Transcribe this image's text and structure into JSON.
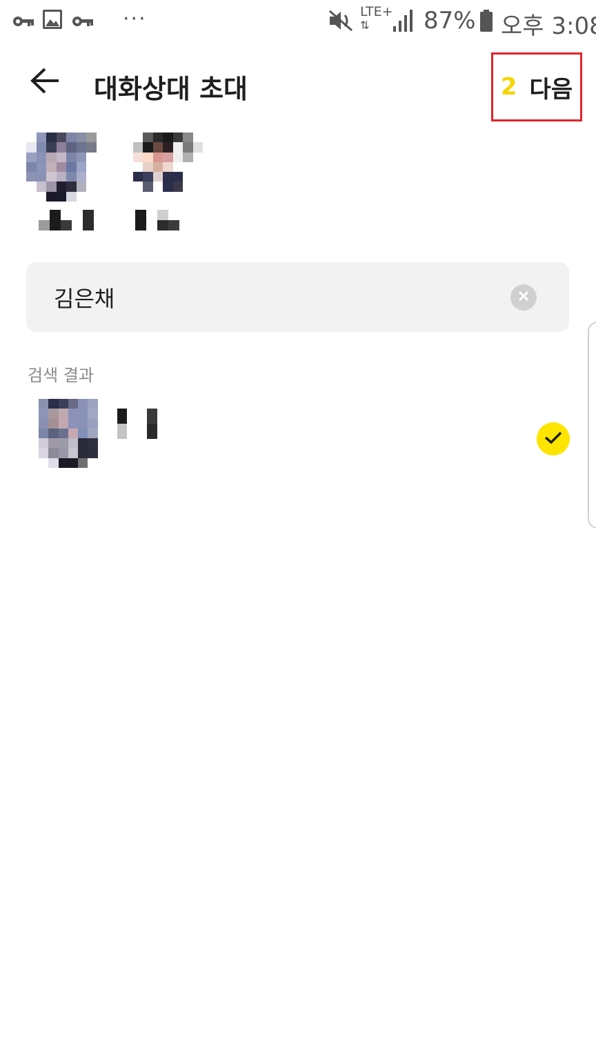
{
  "status_bar": {
    "left_icons": [
      "vpn-key-icon",
      "image-icon",
      "vpn-key-icon",
      "more-dots-icon"
    ],
    "right_icons": [
      "mute-icon",
      "lte-plus-icon",
      "signal-icon",
      "battery-icon"
    ],
    "network": "LTE+",
    "battery_percent": "87%",
    "clock": "오후 3:08"
  },
  "header": {
    "back_icon": "arrow-left-icon",
    "title": "대화상대 초대",
    "selected_count": "2",
    "next_label": "다음"
  },
  "selected_members": [
    {
      "avatar": "pixelated-photo"
    },
    {
      "avatar": "pixelated-photo"
    }
  ],
  "search": {
    "value": "김은채",
    "clear_icon": "clear-circle-icon"
  },
  "results": {
    "heading": "검색 결과",
    "items": [
      {
        "avatar": "pixelated-photo",
        "checked": true,
        "check_icon": "check-icon"
      }
    ]
  },
  "colors": {
    "accent_yellow": "#fee500",
    "count_yellow": "#f5d400",
    "highlight_red": "#e0242c",
    "search_bg": "#f2f2f2",
    "text_dark": "#1e1e1e",
    "text_gray": "#8a8a8a"
  }
}
